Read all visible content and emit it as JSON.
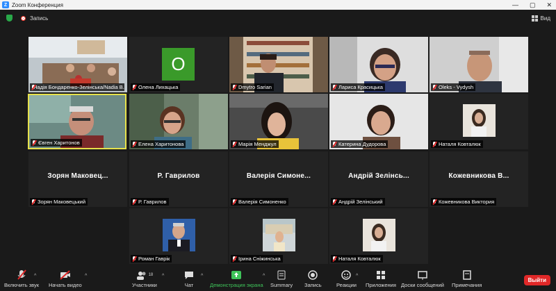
{
  "window": {
    "title": "Zoom Конференция"
  },
  "topbar": {
    "recording_label": "Запись",
    "view_label": "Вид"
  },
  "tiles": [
    {
      "name": "Надія Бондаренко-Зелінська/Nadia B..."
    },
    {
      "name": "Олена Лихацька",
      "avatar_letter": "O"
    },
    {
      "name": "Dmytro Sarian"
    },
    {
      "name": "Лариса Красицька"
    },
    {
      "name": "Oleks - Vydysh"
    },
    {
      "name": "Євген Харитонов"
    },
    {
      "name": "Елена Харитонова"
    },
    {
      "name": "Марія Менджул"
    },
    {
      "name": "Катерина Дудорова"
    },
    {
      "name": "Наталя Ковталюк"
    },
    {
      "name": "Зорян Маковецький",
      "display": "Зорян  Маковец..."
    },
    {
      "name": "Р. Гаврилов",
      "display": "Р. Гаврилов"
    },
    {
      "name": "Валерія Симоненко",
      "display": "Валерія  Симоне..."
    },
    {
      "name": "Андрій Зелінський",
      "display": "Андрій  Зелінсь..."
    },
    {
      "name": "Кожевникова Виктория",
      "display": "Кожевникова  В..."
    },
    {
      "name": "Роман Гаврік"
    },
    {
      "name": "Ірина Сніжинська"
    },
    {
      "name": "Наталя Ковталюк"
    }
  ],
  "toolbar": {
    "unmute": "Включить звук",
    "start_video": "Начать видео",
    "participants": "Участники",
    "participants_count": "18",
    "chat": "Чат",
    "share": "Демонстрация экрана",
    "summary": "Summary",
    "record": "Запись",
    "reactions": "Реакции",
    "apps": "Приложения",
    "whiteboards": "Доски сообщений",
    "notes": "Примечания",
    "leave": "Выйти"
  },
  "colors": {
    "share_green": "#3fc45a",
    "leave_red": "#e02828",
    "active_border": "#e6e14b"
  }
}
